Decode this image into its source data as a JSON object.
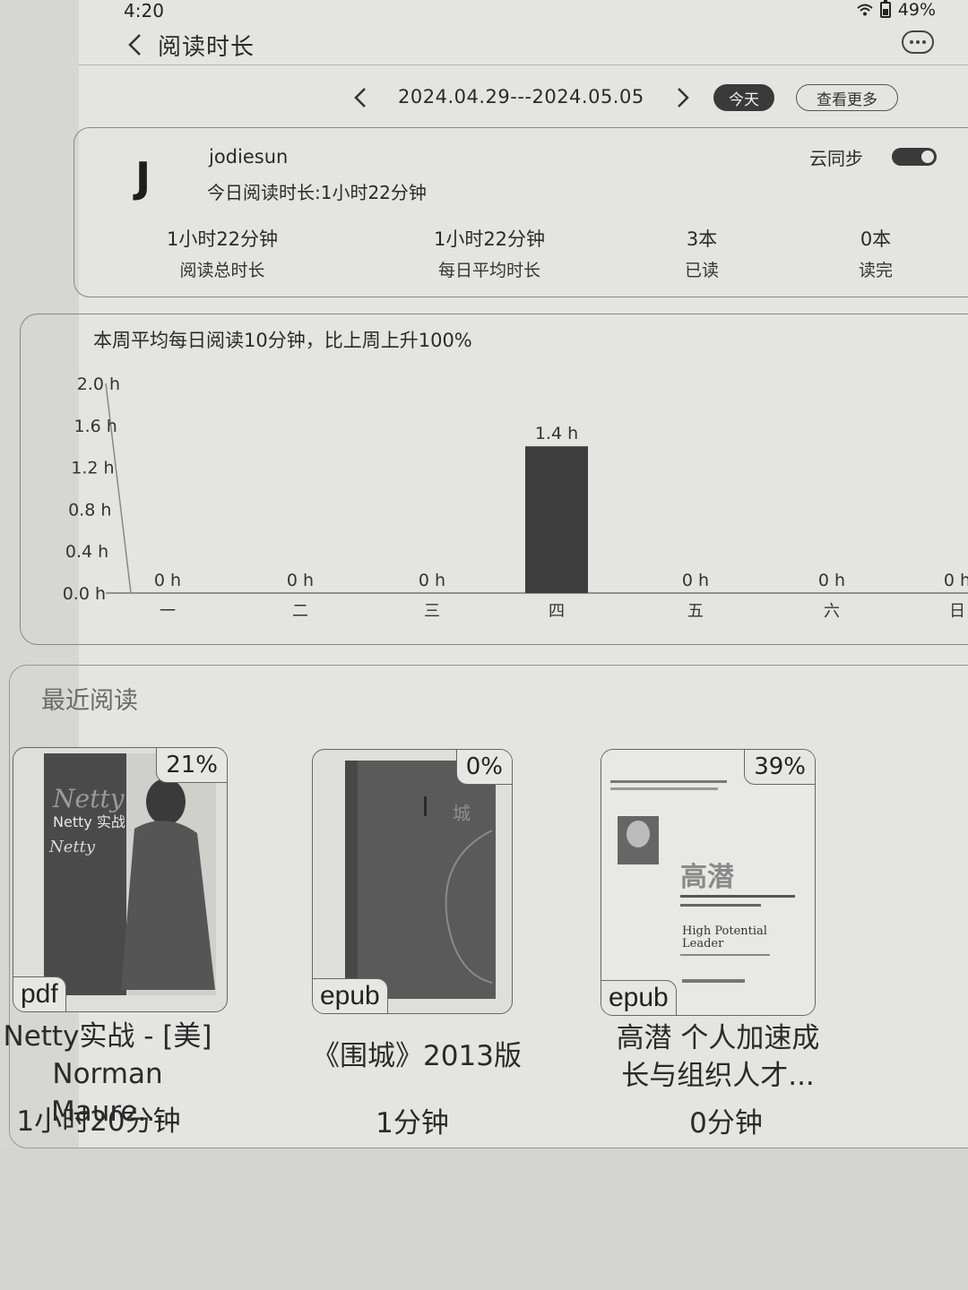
{
  "status": {
    "time": "4:20",
    "battery": "49%"
  },
  "nav": {
    "title": "阅读时长"
  },
  "date_range": {
    "label": "2024.04.29---2024.05.05",
    "today_label": "今天",
    "more_label": "查看更多"
  },
  "profile": {
    "avatar_letter": "J",
    "username": "jodiesun",
    "today_reading": "今日阅读时长:1小时22分钟",
    "sync_label": "云同步",
    "sync_on": true,
    "stats": [
      {
        "value": "1小时22分钟",
        "label": "阅读总时长"
      },
      {
        "value": "1小时22分钟",
        "label": "每日平均时长"
      },
      {
        "value": "3本",
        "label": "已读"
      },
      {
        "value": "0本",
        "label": "读完"
      }
    ]
  },
  "chart_data": {
    "type": "bar",
    "title": "本周平均每日阅读10分钟，比上周上升100%",
    "categories": [
      "一",
      "二",
      "三",
      "四",
      "五",
      "六",
      "日"
    ],
    "values": [
      0,
      0,
      0,
      1.4,
      0,
      0,
      0
    ],
    "value_labels": [
      "0 h",
      "0 h",
      "0 h",
      "1.4 h",
      "0 h",
      "0 h",
      "0 h"
    ],
    "ylim": [
      0,
      2.0
    ],
    "yticks": [
      0,
      0.4,
      0.8,
      1.2,
      1.6,
      2.0
    ],
    "ytick_labels": [
      "0.0 h",
      "0.4 h",
      "0.8 h",
      "1.2 h",
      "1.6 h",
      "2.0 h"
    ],
    "bar_color": "#3d3d3d"
  },
  "recent": {
    "title": "最近阅读",
    "books": [
      {
        "progress": "21%",
        "format": "pdf",
        "name_line1": "Netty实战 - [美]",
        "name_line2": "Norman Maure...",
        "time": "1小时20分钟",
        "cover_text": "Netty 实战"
      },
      {
        "progress": "0%",
        "format": "epub",
        "name_line1": "《围城》2013版",
        "name_line2": "",
        "time": "1分钟",
        "cover_text": "城"
      },
      {
        "progress": "39%",
        "format": "epub",
        "name_line1": "高潜 个人加速成",
        "name_line2": "长与组织人才...",
        "time": "0分钟",
        "cover_text": "高潜"
      }
    ]
  }
}
